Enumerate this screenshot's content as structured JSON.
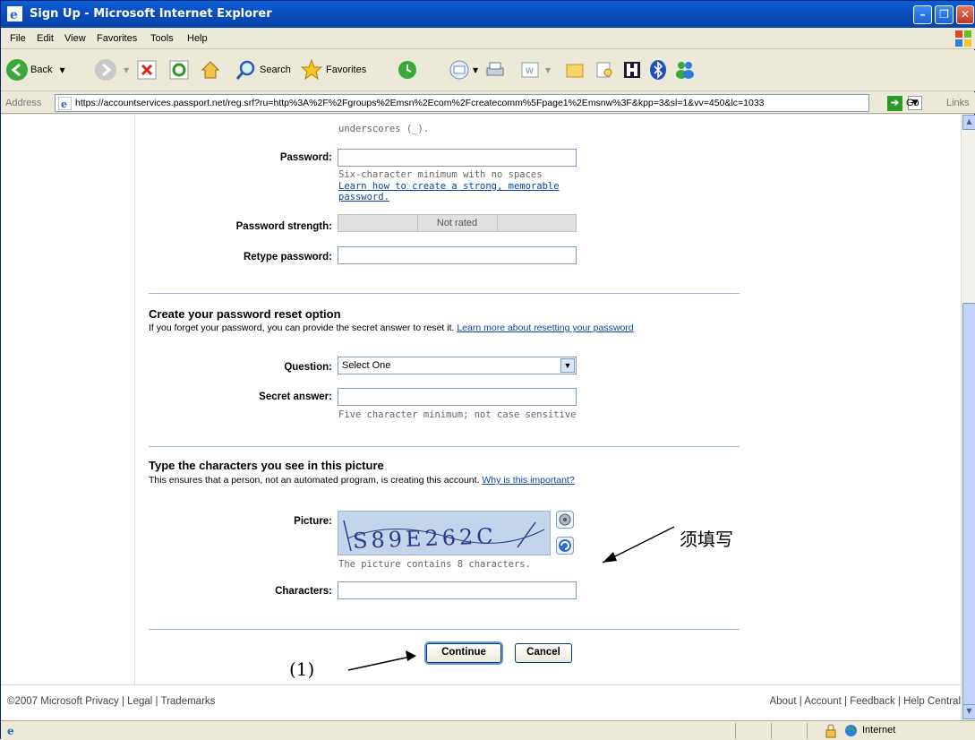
{
  "window": {
    "title": "Sign Up - Microsoft Internet Explorer",
    "minimize": "–",
    "maximize": "❐",
    "close": "✕"
  },
  "menu": [
    "File",
    "Edit",
    "View",
    "Favorites",
    "Tools",
    "Help"
  ],
  "toolbar": {
    "back": "Back",
    "search": "Search",
    "favorites": "Favorites"
  },
  "address": {
    "label": "Address",
    "url": "https://accountservices.passport.net/reg.srf?ru=http%3A%2F%2Fgroups%2Emsn%2Ecom%2Fcreatecomm%5Fpage1%2Emsnw%3F&kpp=3&sl=1&vv=450&lc=1033",
    "go": "Go",
    "links": "Links"
  },
  "form": {
    "username_hint_tail": "underscores (_).",
    "password_label": "Password:",
    "password_hint": "Six-character minimum with no spaces",
    "password_link": "Learn how to create a strong, memorable password.",
    "strength_label": "Password strength:",
    "strength_value": "Not rated",
    "retype_label": "Retype password:",
    "reset_title": "Create your password reset option",
    "reset_sub": "If you forget your password, you can provide the secret answer to reset it.",
    "reset_link": "Learn more about resetting your password",
    "question_label": "Question:",
    "question_value": "Select One",
    "secret_label": "Secret answer:",
    "secret_hint": "Five character minimum; not case sensitive",
    "captcha_title": "Type the characters you see in this picture",
    "captcha_sub": "This ensures that a person, not an automated program, is creating this account.",
    "captcha_link": "Why is this important?",
    "picture_label": "Picture:",
    "captcha_text": "S89E262C",
    "picture_hint": "The picture contains 8 characters.",
    "characters_label": "Characters:",
    "continue": "Continue",
    "cancel": "Cancel"
  },
  "footer": {
    "left": "©2007 Microsoft   Privacy | Legal | Trademarks",
    "right": "About | Account | Feedback | Help Central"
  },
  "annotations": {
    "required": "须填写",
    "step": "(1)"
  },
  "status": {
    "zone": "Internet"
  }
}
